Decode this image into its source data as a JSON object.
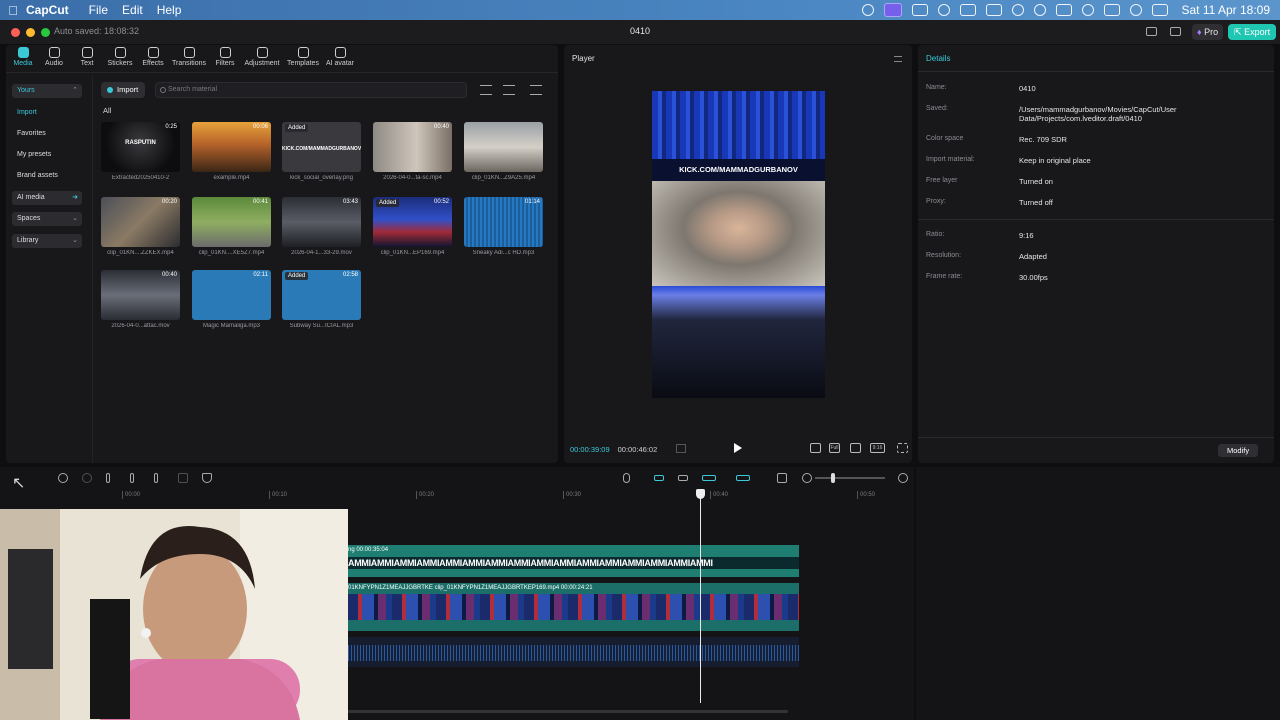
{
  "menubar": {
    "app_name": "CapCut",
    "items": [
      "File",
      "Edit",
      "Help"
    ],
    "clock": "Sat 11 Apr  18:09"
  },
  "titlebar": {
    "autosave": "Auto saved: 18:08:32",
    "project_title": "0410",
    "pro_label": "Pro",
    "export_label": "Export"
  },
  "categories": [
    "Media",
    "Audio",
    "Text",
    "Stickers",
    "Effects",
    "Transitions",
    "Filters",
    "Adjustment",
    "Templates",
    "AI avatar"
  ],
  "sidebar": {
    "items": [
      "Yours",
      "Import",
      "Favorites",
      "My presets",
      "Brand assets",
      "AI media",
      "Spaces",
      "Library"
    ]
  },
  "media": {
    "import_label": "Import",
    "search_placeholder": "Search material",
    "filter_label": "All",
    "tiles": [
      {
        "name": "Extracted20250410-2",
        "duration": "0:25",
        "badge": "",
        "overlay": "RASPUTIN"
      },
      {
        "name": "example.mp4",
        "duration": "00:06",
        "badge": "",
        "overlay": ""
      },
      {
        "name": "kick_social_overlay.png",
        "duration": "",
        "badge": "Added",
        "overlay": "KICK.COM/MAMMADGURBANOV"
      },
      {
        "name": "2026-04-0...ta-sc.mp4",
        "duration": "00:40",
        "badge": "",
        "overlay": ""
      },
      {
        "name": "clip_01KN...Z9A25.mp4",
        "duration": "",
        "badge": "",
        "overlay": ""
      },
      {
        "name": "clip_01KN....ZZKEX.mp4",
        "duration": "00:20",
        "badge": "",
        "overlay": ""
      },
      {
        "name": "clip_01KN....XE5Z7.mp4",
        "duration": "00:41",
        "badge": "",
        "overlay": ""
      },
      {
        "name": "2026-04-1...33-29.mov",
        "duration": "03:43",
        "badge": "",
        "overlay": ""
      },
      {
        "name": "clip_01KN...EP169.mp4",
        "duration": "00:52",
        "badge": "Added",
        "overlay": ""
      },
      {
        "name": "Sneaky Adi...c HD.mp3",
        "duration": "01:14",
        "badge": "",
        "overlay": ""
      },
      {
        "name": "2026-04-0...attac.mov",
        "duration": "00:40",
        "badge": "",
        "overlay": ""
      },
      {
        "name": "Magic Mamaliga.mp3",
        "duration": "02:11",
        "badge": "",
        "overlay": ""
      },
      {
        "name": "Subway Su...ICIAL.mp3",
        "duration": "02:58",
        "badge": "Added",
        "overlay": ""
      }
    ]
  },
  "player": {
    "title": "Player",
    "overlay_text": "KICK.COM/MAMMADGURBANOV",
    "current_time": "00:00:39:09",
    "total_time": "00:00:46:02",
    "ratio_label": "9:16",
    "full_label": "Full"
  },
  "details": {
    "title": "Details",
    "rows": [
      {
        "key": "Name:",
        "value": "0410"
      },
      {
        "key": "Saved:",
        "value": "/Users/mammadgurbanov/Movies/CapCut/User Data/Projects/com.lveditor.draft/0410"
      },
      {
        "key": "Color space",
        "value": "Rec. 709 SDR"
      },
      {
        "key": "Import material:",
        "value": "Keep in original place"
      },
      {
        "key": "Free layer",
        "value": "Turned on"
      },
      {
        "key": "Proxy:",
        "value": "Turned off"
      },
      {
        "key": "Ratio:",
        "value": "9:16"
      },
      {
        "key": "Resolution:",
        "value": "Adapted"
      },
      {
        "key": "Frame rate:",
        "value": "30.00fps"
      }
    ],
    "modify_label": "Modify"
  },
  "timeline": {
    "ruler": [
      "00:00",
      "00:10",
      "00:20",
      "00:30",
      "00:40",
      "00:50"
    ],
    "text_clip_label": "ng  00:00:35:04",
    "text_clip_strip": "AMMIAMMIAMMIAMMIAMMIAMMIAMMIAMMIAMMIAMMIAMMIAMMIAMMIAMMIAMMIAMMI",
    "video_clip_label": "01KNFYPN1Z1MEAJJGBRTKE  clip_01KNFYPN1Z1MEAJJGBRTKEP169.mp4  00:00:24:21"
  },
  "colors": {
    "accent": "#3cc9d7",
    "export": "#1fc7b3",
    "text_clip": "#1d7e71",
    "video_clip": "#1b6f68"
  }
}
